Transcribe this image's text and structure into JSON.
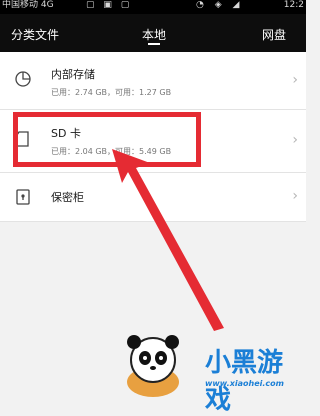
{
  "status_bar": {
    "carrier": "中国移动 4G",
    "clock": "12:2",
    "icons": [
      "signal-icon",
      "photo-icon",
      "app-icon",
      "battery-icon"
    ]
  },
  "tabs": [
    {
      "label": "分类文件",
      "selected": false
    },
    {
      "label": "本地",
      "selected": true
    },
    {
      "label": "网盘",
      "selected": false
    }
  ],
  "storage": [
    {
      "icon": "pie-chart-icon",
      "title": "内部存储",
      "detail": "已用：2.74 GB，可用：1.27 GB"
    },
    {
      "icon": "sd-card-icon",
      "title": "SD 卡",
      "detail": "已用：2.04 GB，可用：5.49 GB"
    },
    {
      "icon": "safe-icon",
      "title": "保密柜",
      "detail": ""
    }
  ],
  "watermark": {
    "text": "小黑游戏",
    "url": "www.xiaohei.com"
  },
  "colors": {
    "accent_red": "#e52b33",
    "tab_bar": "#0d0d0d",
    "logo_blue": "#1b7fd6"
  }
}
